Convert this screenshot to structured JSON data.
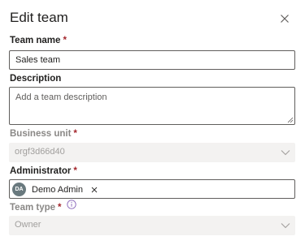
{
  "panel": {
    "title": "Edit team"
  },
  "fields": {
    "team_name": {
      "label": "Team name",
      "required_mark": "*",
      "value": "Sales team"
    },
    "description": {
      "label": "Description",
      "placeholder": "Add a team description",
      "value": ""
    },
    "business_unit": {
      "label": "Business unit",
      "required_mark": "*",
      "value": "orgf3d66d40"
    },
    "administrator": {
      "label": "Administrator",
      "required_mark": "*",
      "persona_initials": "DA",
      "persona_name": "Demo Admin"
    },
    "team_type": {
      "label": "Team type",
      "required_mark": "*",
      "value": "Owner"
    }
  },
  "icons": {
    "close": "close-icon",
    "chevron": "chevron-down-icon",
    "info": "info-icon",
    "remove": "remove-icon"
  },
  "colors": {
    "required": "#a4262c",
    "avatar_bg": "#69797e",
    "disabled_bg": "#f3f2f1",
    "info_icon": "#8764b8"
  }
}
